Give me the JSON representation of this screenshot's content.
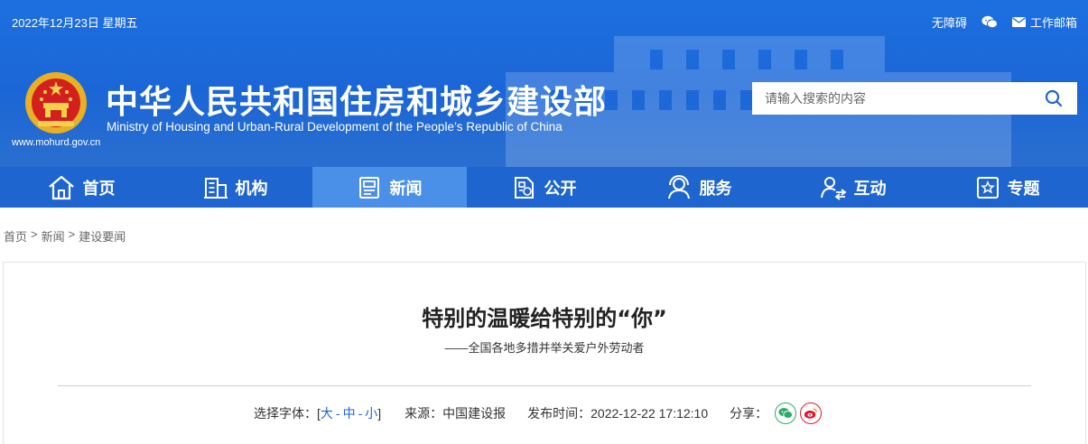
{
  "header": {
    "date": "2022年12月23日 星期五",
    "accessibility_label": "无障碍",
    "mail_label": "工作邮箱",
    "site_title": "中华人民共和国住房和城乡建设部",
    "site_subtitle": "Ministry of Housing and Urban-Rural Development of the People’s Republic of China",
    "site_url": "www.mohurd.gov.cn",
    "search_placeholder": "请输入搜索的内容"
  },
  "nav": {
    "items": [
      {
        "label": "首页",
        "icon": "home-icon"
      },
      {
        "label": "机构",
        "icon": "building-icon"
      },
      {
        "label": "新闻",
        "icon": "news-icon",
        "active": true
      },
      {
        "label": "公开",
        "icon": "document-icon"
      },
      {
        "label": "服务",
        "icon": "service-icon"
      },
      {
        "label": "互动",
        "icon": "interaction-icon"
      },
      {
        "label": "专题",
        "icon": "topic-icon"
      }
    ]
  },
  "breadcrumb": [
    "首页",
    ">",
    "新闻",
    ">",
    "建设要闻"
  ],
  "article": {
    "title": "特别的温暖给特别的“你”",
    "subtitle": "——全国各地多措并举关爱户外劳动者",
    "font_label": "选择字体：[",
    "font_large": "大",
    "font_medium": "中",
    "font_small": "小",
    "font_close": "]",
    "source_label": "来源：",
    "source": "中国建设报",
    "time_label": "发布时间：",
    "time": "2022-12-22 17:12:10",
    "share_label": "分享："
  },
  "colors": {
    "header_blue": "#1d6fe0",
    "nav_blue": "#1f65cf",
    "nav_active": "#4b90e8",
    "wechat_green": "#2aae67",
    "weibo_red": "#e6162d"
  }
}
